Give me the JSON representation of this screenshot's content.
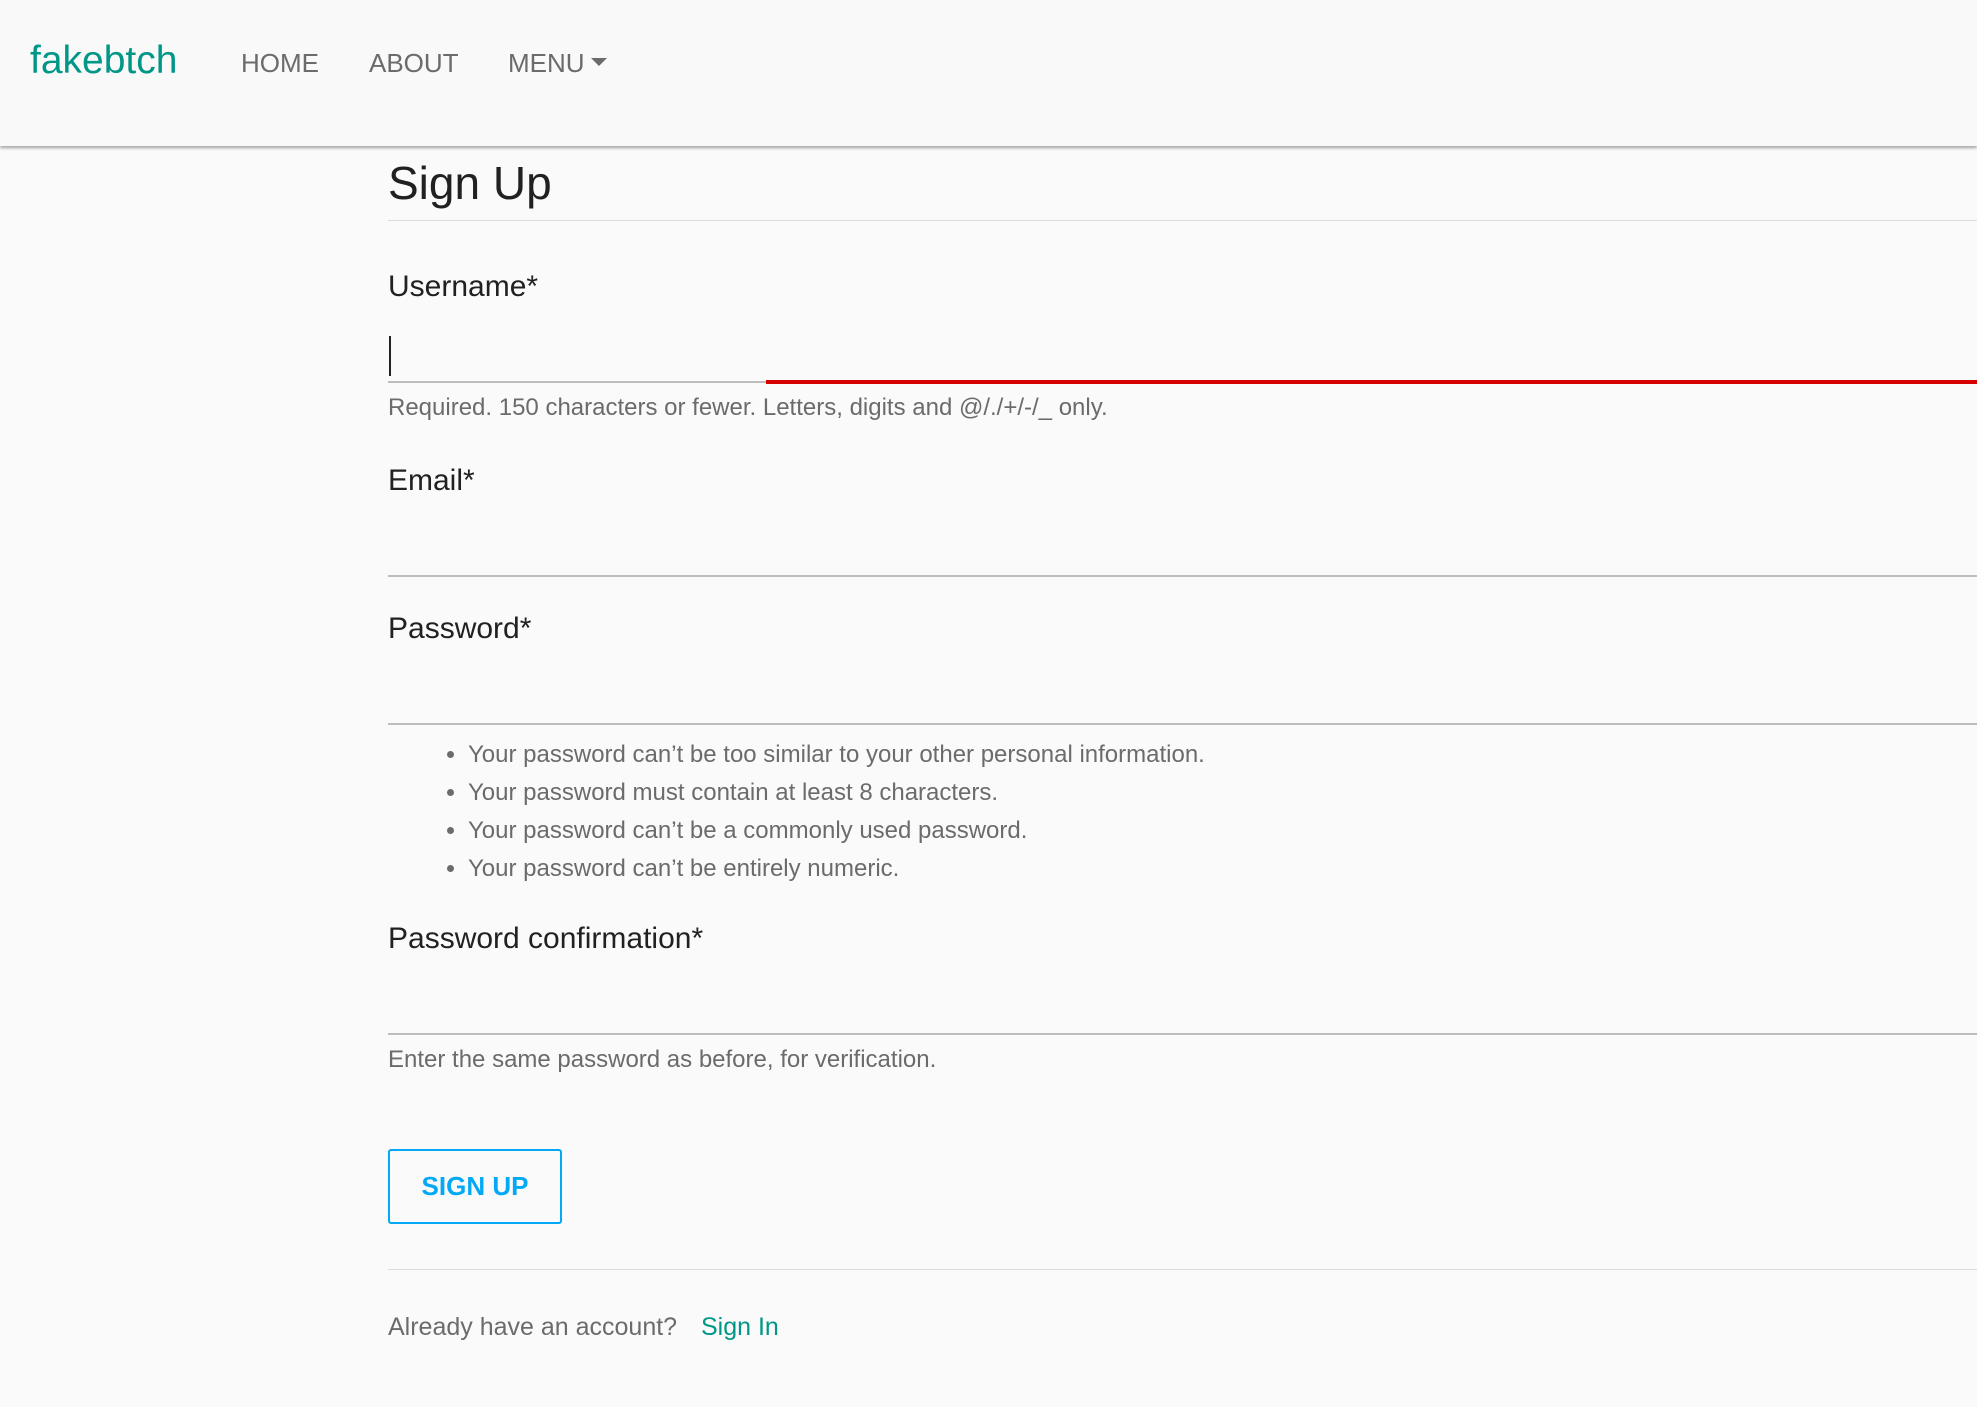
{
  "navbar": {
    "brand": "fakebtch",
    "links": [
      {
        "label": "HOME"
      },
      {
        "label": "ABOUT"
      },
      {
        "label": "MENU"
      }
    ]
  },
  "colors": {
    "brand": "#009688",
    "button": "#03a9f4",
    "focus_error": "#d50000"
  },
  "form": {
    "title": "Sign Up",
    "username": {
      "label": "Username*",
      "value": "",
      "help": "Required. 150 characters or fewer. Letters, digits and @/./+/-/_ only."
    },
    "email": {
      "label": "Email*",
      "value": ""
    },
    "password": {
      "label": "Password*",
      "value": "",
      "help_items": [
        "Your password can’t be too similar to your other personal information.",
        "Your password must contain at least 8 characters.",
        "Your password can’t be a commonly used password.",
        "Your password can’t be entirely numeric."
      ]
    },
    "password_confirmation": {
      "label": "Password confirmation*",
      "value": "",
      "help": "Enter the same password as before, for verification."
    },
    "submit_label": "SIGN UP"
  },
  "footer": {
    "prompt": "Already have an account?",
    "link_label": "Sign In"
  }
}
